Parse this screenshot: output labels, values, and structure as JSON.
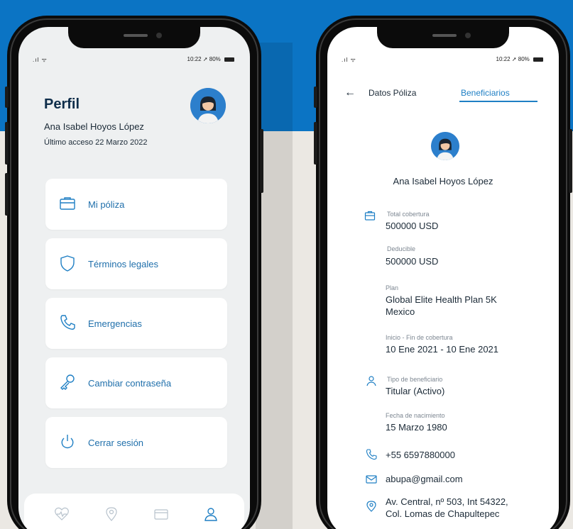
{
  "colors": {
    "brand_blue": "#0b74c4",
    "accent": "#1f7fc4",
    "text_dark": "#1b2a37",
    "title_dark": "#0e2d4a"
  },
  "status_bar": {
    "time": "10:22",
    "battery": "80%"
  },
  "left_screen": {
    "title": "Perfil",
    "user_name": "Ana Isabel Hoyos López",
    "last_access": "Último acceso 22 Marzo 2022",
    "menu": [
      {
        "label": "Mi póliza",
        "icon": "briefcase-icon"
      },
      {
        "label": "Términos legales",
        "icon": "shield-icon"
      },
      {
        "label": "Emergencias",
        "icon": "phone-icon"
      },
      {
        "label": "Cambiar contraseña",
        "icon": "key-icon"
      },
      {
        "label": "Cerrar sesión",
        "icon": "power-icon"
      }
    ],
    "tabbar": [
      "heart-pulse-icon",
      "location-pin-icon",
      "card-icon",
      "user-icon"
    ]
  },
  "right_screen": {
    "tabs": [
      "Datos Póliza",
      "Beneficiarios"
    ],
    "active_tab": "Beneficiarios",
    "user_name": "Ana Isabel Hoyos López",
    "fields": {
      "total_label": "Total cobertura",
      "total_value": "500000 USD",
      "deductible_label": "Deducible",
      "deductible_value": "500000 USD",
      "plan_label": "Plan",
      "plan_value_line1": "Global Elite Health Plan 5K",
      "plan_value_line2": "Mexico",
      "coverage_label": "Inicio - Fin de cobertura",
      "coverage_value": "10 Ene 2021 - 10 Ene 2021",
      "beneficiary_type_label": "Tipo de beneficiario",
      "beneficiary_type_value": "Titular (Activo)",
      "birth_label": "Fecha de nacimiento",
      "birth_value": "15 Marzo 1980",
      "phone": "+55  6597880000",
      "email": "abupa@gmail.com",
      "address_line1": "Av. Central, nº 503, Int 54322,",
      "address_line2": "Col. Lomas de Chapultepec"
    }
  }
}
